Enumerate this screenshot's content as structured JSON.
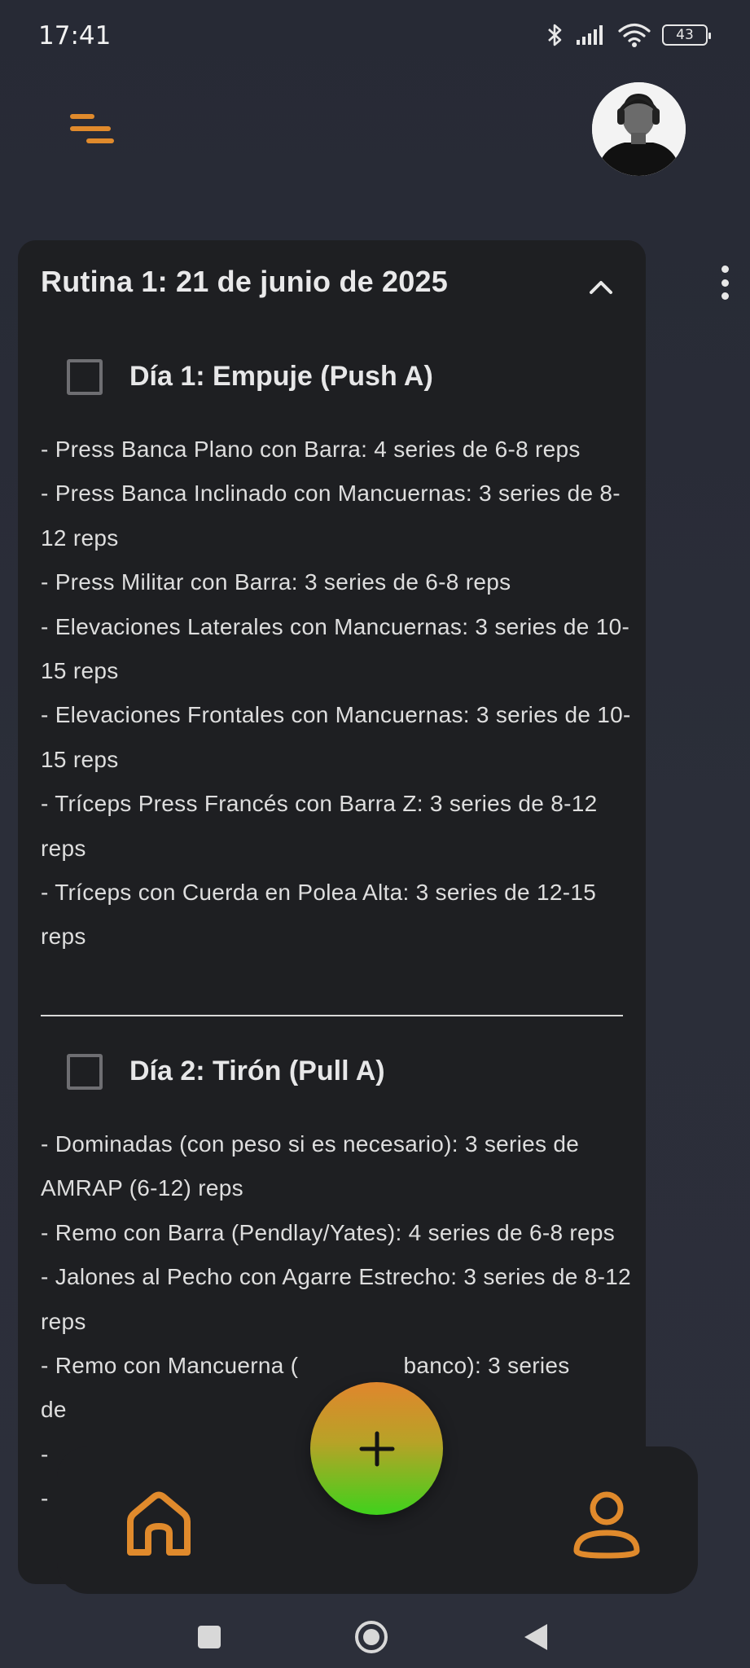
{
  "status_bar": {
    "time": "17:41",
    "battery": "43"
  },
  "header": {
    "menu_icon": "menu-icon",
    "avatar_icon": "profile-photo"
  },
  "routine": {
    "title": "Rutina 1: 21 de junio de 2025",
    "collapse_icon": "chevron-up-icon",
    "days": [
      {
        "title": "Día 1: Empuje (Push A)",
        "checked": false,
        "exercises": [
          "- Press Banca Plano con Barra: 4 series de 6-8 reps",
          "- Press Banca Inclinado con Mancuernas: 3 series de 8-12 reps",
          "- Press Militar con Barra: 3 series de 6-8 reps",
          "- Elevaciones Laterales con Mancuernas: 3 series de 10-15 reps",
          "- Elevaciones Frontales con Mancuernas: 3 series de 10-15 reps",
          "- Tríceps Press Francés con Barra Z: 3 series de 8-12 reps",
          "- Tríceps con Cuerda en Polea Alta: 3 series de 12-15 reps"
        ]
      },
      {
        "title": "Día 2: Tirón (Pull A)",
        "checked": false,
        "exercises": [
          "- Dominadas (con peso si es necesario): 3 series de AMRAP (6-12) reps",
          "- Remo con Barra (Pendlay/Yates): 4 series de 6-8 reps",
          "- Jalones al Pecho con Agarre Estrecho: 3 series de 8-12 reps",
          "- Remo con Mancuerna (                banco): 3 series",
          "de",
          "-",
          "-"
        ]
      }
    ]
  },
  "bottom_nav": {
    "home_icon": "home-icon",
    "add_icon": "plus-icon",
    "profile_icon": "user-icon"
  },
  "colors": {
    "accent": "#e08a2c",
    "fab_top": "#e0862d",
    "fab_bottom": "#3fd21c",
    "card_bg": "#1e1f22",
    "page_bg": "#2a2d38"
  }
}
